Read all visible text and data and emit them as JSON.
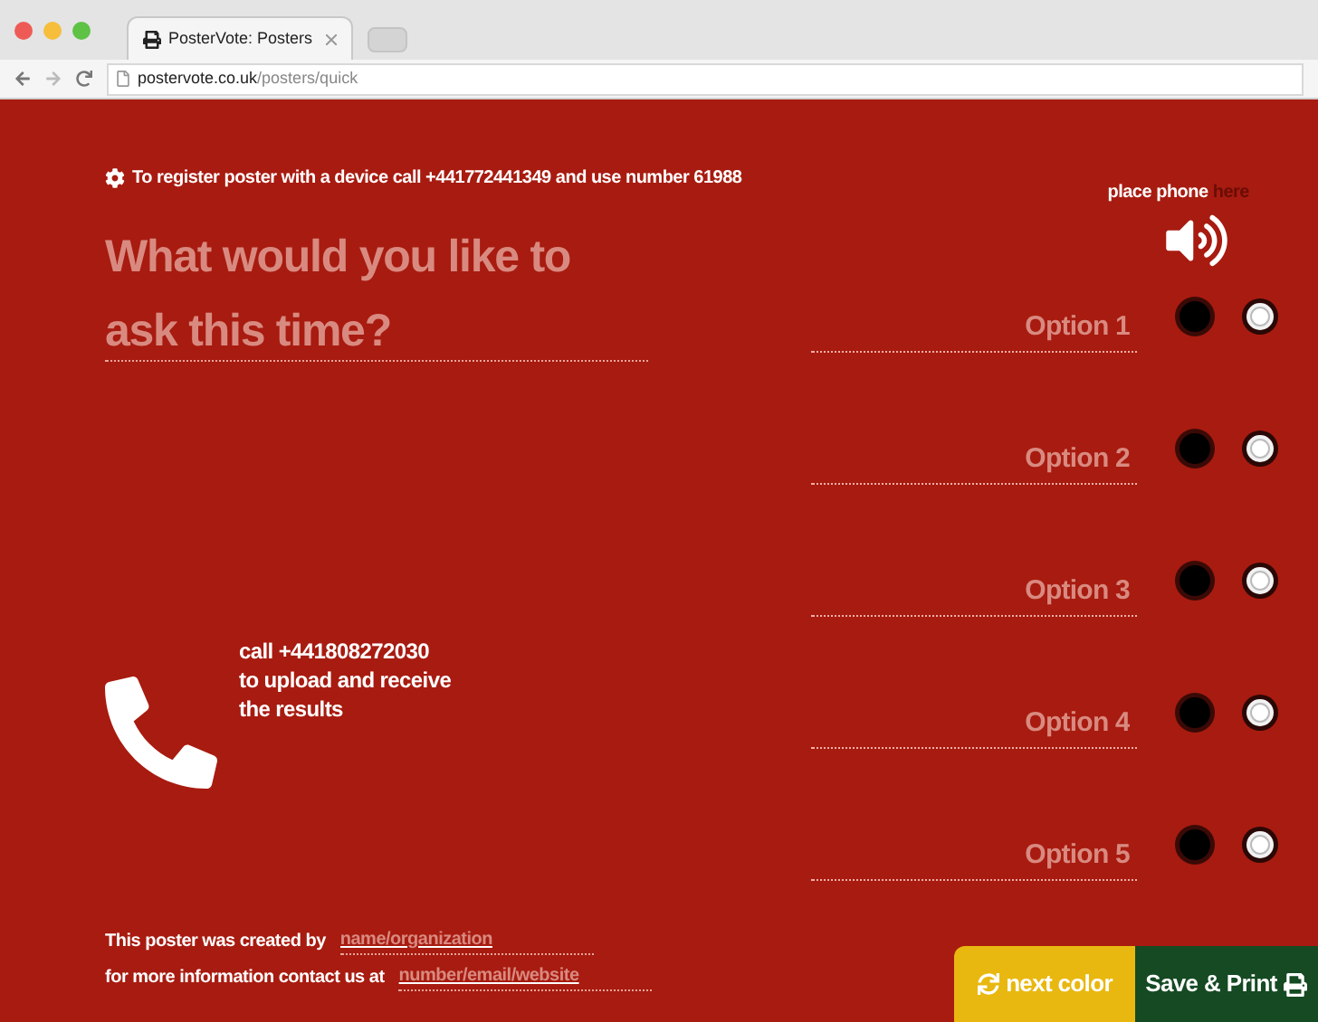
{
  "browser": {
    "tab_title": "PosterVote: Posters",
    "url_host": "postervote.co.uk",
    "url_path": "/posters/quick"
  },
  "register_notice": "To register poster with a device call +441772441349 and use number 61988",
  "place_phone": {
    "text": "place phone",
    "highlight": "here"
  },
  "question": {
    "placeholder": "What would you like to ask this time?"
  },
  "options": [
    {
      "placeholder": "Option 1"
    },
    {
      "placeholder": "Option 2"
    },
    {
      "placeholder": "Option 3"
    },
    {
      "placeholder": "Option 4"
    },
    {
      "placeholder": "Option 5"
    }
  ],
  "results_call": [
    "call +441808272030",
    "to upload and receive",
    "the results"
  ],
  "credits": [
    {
      "label": "This poster was created by",
      "placeholder": "name/organization"
    },
    {
      "label": "for more information contact us at",
      "placeholder": "number/email/website"
    }
  ],
  "buttons": [
    {
      "kind": "next",
      "label": "next color"
    },
    {
      "kind": "print",
      "label": "Save & Print"
    }
  ]
}
